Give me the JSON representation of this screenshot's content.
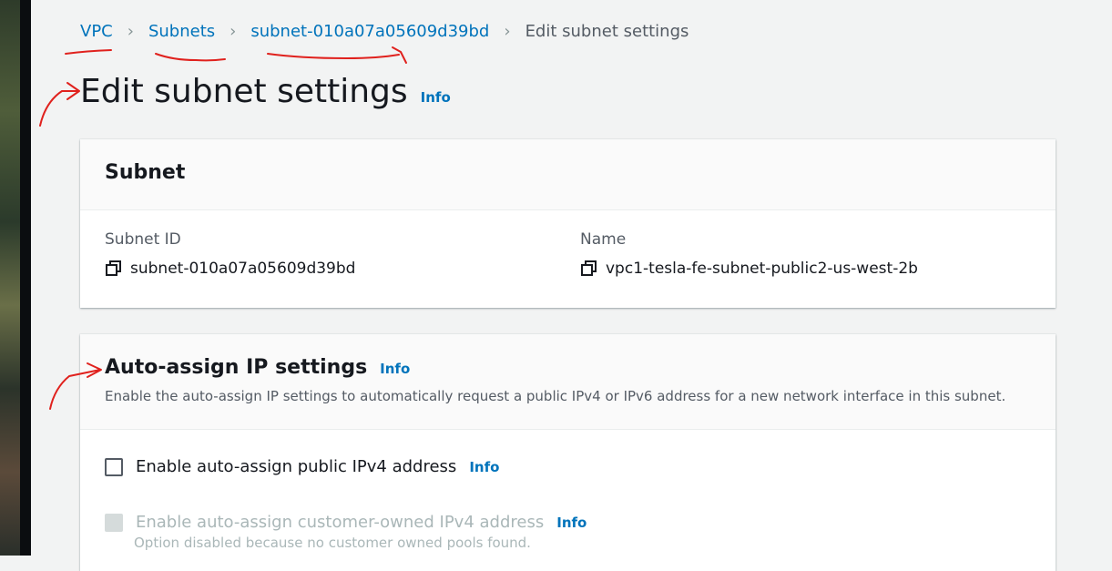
{
  "breadcrumb": {
    "items": [
      {
        "label": "VPC"
      },
      {
        "label": "Subnets"
      },
      {
        "label": "subnet-010a07a05609d39bd"
      },
      {
        "label": "Edit subnet settings"
      }
    ],
    "separator": "›"
  },
  "header": {
    "title": "Edit subnet settings",
    "info_label": "Info"
  },
  "subnet_panel": {
    "title": "Subnet",
    "fields": [
      {
        "label": "Subnet ID",
        "value": "subnet-010a07a05609d39bd",
        "icon": "copy-icon"
      },
      {
        "label": "Name",
        "value": "vpc1-tesla-fe-subnet-public2-us-west-2b",
        "icon": "copy-icon"
      }
    ]
  },
  "auto_assign_panel": {
    "title": "Auto-assign IP settings",
    "info_label": "Info",
    "description": "Enable the auto-assign IP settings to automatically request a public IPv4 or IPv6 address for a new network interface in this subnet.",
    "options": [
      {
        "label": "Enable auto-assign public IPv4 address",
        "info_label": "Info",
        "checked": false,
        "disabled": false
      },
      {
        "label": "Enable auto-assign customer-owned IPv4 address",
        "info_label": "Info",
        "checked": false,
        "disabled": true,
        "hint": "Option disabled because no customer owned pools found."
      }
    ]
  },
  "colors": {
    "link": "#0073bb",
    "annotation": "#e0211d",
    "background": "#f2f3f3",
    "panel": "#ffffff"
  }
}
